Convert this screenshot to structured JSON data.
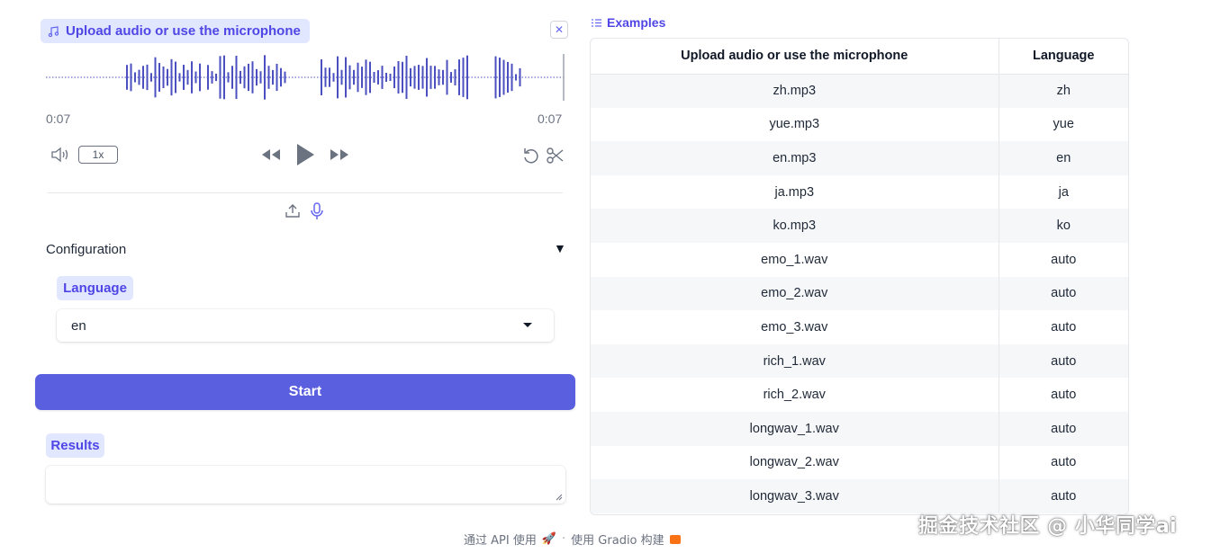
{
  "audio": {
    "label": "Upload audio or use the microphone",
    "time_current": "0:07",
    "time_total": "0:07",
    "playback_rate": "1x"
  },
  "config": {
    "title": "Configuration",
    "toggle": "▼",
    "language_label": "Language",
    "language_value": "en"
  },
  "start_label": "Start",
  "results": {
    "label": "Results",
    "value": ""
  },
  "examples": {
    "title": "Examples",
    "columns": [
      "Upload audio or use the microphone",
      "Language"
    ],
    "rows": [
      [
        "zh.mp3",
        "zh"
      ],
      [
        "yue.mp3",
        "yue"
      ],
      [
        "en.mp3",
        "en"
      ],
      [
        "ja.mp3",
        "ja"
      ],
      [
        "ko.mp3",
        "ko"
      ],
      [
        "emo_1.wav",
        "auto"
      ],
      [
        "emo_2.wav",
        "auto"
      ],
      [
        "emo_3.wav",
        "auto"
      ],
      [
        "rich_1.wav",
        "auto"
      ],
      [
        "rich_2.wav",
        "auto"
      ],
      [
        "longwav_1.wav",
        "auto"
      ],
      [
        "longwav_2.wav",
        "auto"
      ],
      [
        "longwav_3.wav",
        "auto"
      ]
    ]
  },
  "footer": {
    "api_text": "通过 API 使用",
    "separator": "·",
    "built_text": "使用 Gradio 构建"
  },
  "watermark": "掘金技术社区 @ 小华同学ai",
  "colors": {
    "accent": "#5a5fe0",
    "label_bg": "#e0e7ff",
    "label_text": "#4f46e5",
    "waveform": "#4b4fbf"
  }
}
